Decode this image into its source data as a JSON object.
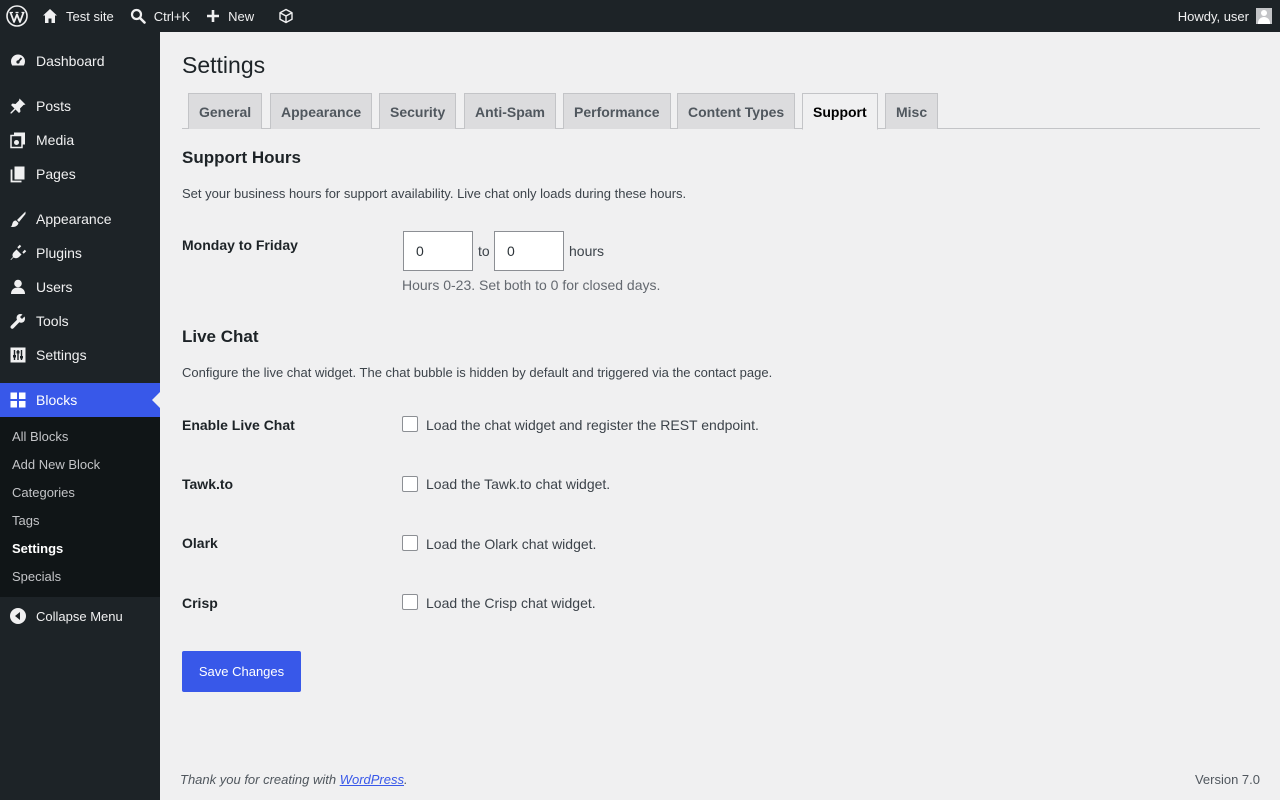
{
  "adminbar": {
    "site_name": "Test site",
    "search_shortcut": "Ctrl+K",
    "new_label": "New",
    "howdy": "Howdy, user"
  },
  "sidebar": {
    "items": [
      {
        "label": "Dashboard",
        "icon": "dashboard-icon"
      },
      {
        "label": "Posts",
        "icon": "pin-icon"
      },
      {
        "label": "Media",
        "icon": "media-icon"
      },
      {
        "label": "Pages",
        "icon": "pages-icon"
      },
      {
        "label": "Appearance",
        "icon": "brush-icon"
      },
      {
        "label": "Plugins",
        "icon": "plug-icon"
      },
      {
        "label": "Users",
        "icon": "user-icon"
      },
      {
        "label": "Tools",
        "icon": "wrench-icon"
      },
      {
        "label": "Settings",
        "icon": "settings-icon"
      },
      {
        "label": "Blocks",
        "icon": "blocks-icon",
        "current": true
      }
    ],
    "submenu": [
      "All Blocks",
      "Add New Block",
      "Categories",
      "Tags",
      "Settings",
      "Specials"
    ],
    "submenu_current": "Settings",
    "collapse": "Collapse Menu"
  },
  "page": {
    "title": "Settings",
    "tabs": [
      "General",
      "Appearance",
      "Security",
      "Anti-Spam",
      "Performance",
      "Content Types",
      "Support",
      "Misc"
    ],
    "active_tab": "Support"
  },
  "support_hours": {
    "heading": "Support Hours",
    "description": "Set your business hours for support availability. Live chat only loads during these hours.",
    "row_label": "Monday to Friday",
    "from_value": "0",
    "to_text": "to",
    "to_value": "0",
    "unit": "hours",
    "hint": "Hours 0-23. Set both to 0 for closed days."
  },
  "live_chat": {
    "heading": "Live Chat",
    "description": "Configure the live chat widget. The chat bubble is hidden by default and triggered via the contact page.",
    "rows": [
      {
        "label": "Enable Live Chat",
        "text": "Load the chat widget and register the REST endpoint.",
        "checked": false
      },
      {
        "label": "Tawk.to",
        "text": "Load the Tawk.to chat widget.",
        "checked": false
      },
      {
        "label": "Olark",
        "text": "Load the Olark chat widget.",
        "checked": false
      },
      {
        "label": "Crisp",
        "text": "Load the Crisp chat widget.",
        "checked": false
      }
    ]
  },
  "save_label": "Save Changes",
  "footer": {
    "thanks_prefix": "Thank you for creating with ",
    "wordpress_link": "WordPress",
    "thanks_suffix": ".",
    "version": "Version 7.0"
  },
  "colors": {
    "accent": "#3858e9",
    "adminbar_bg": "#1d2327",
    "page_bg": "#f0f0f1"
  }
}
